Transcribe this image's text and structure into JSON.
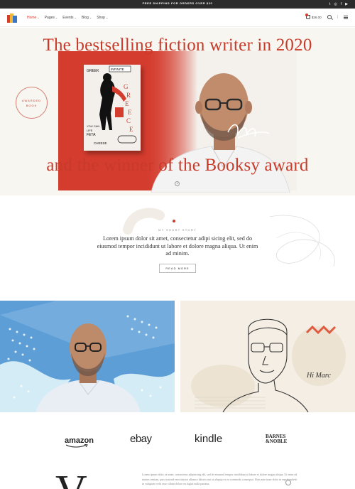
{
  "topbar": {
    "promo": "FREE SHIPPING FOR ORDERS OVER $20",
    "socials": [
      "t",
      "◎",
      "f",
      "▶"
    ]
  },
  "nav": {
    "items": [
      {
        "label": "Home",
        "active": true
      },
      {
        "label": "Pages",
        "active": false
      },
      {
        "label": "Events",
        "active": false
      },
      {
        "label": "Blog",
        "active": false
      },
      {
        "label": "Shop",
        "active": false
      }
    ],
    "chevron": "⌄"
  },
  "header": {
    "cart_total": "$26.00",
    "separator": "|"
  },
  "hero": {
    "title_top": "The bestselling fiction writer in 2020",
    "title_bottom": "and the winner of the Booksy award",
    "badge_line1": "AWARDED",
    "badge_line2": "BOOK",
    "book_title": "GREECE",
    "book_words": [
      "INFINITE",
      "GREEK",
      "FETA",
      "YOU CAN",
      "CHEESE",
      "LIFE"
    ],
    "accent_color": "#d43c2e"
  },
  "story": {
    "label": "MY SHORT STORY",
    "text": "Lorem ipsum dolor sit amet, consectetur adipi sicing elit, sed do eiusmod tempor incididunt ut labore et dolore magna aliqua. Ut enim ad minim.",
    "button": "READ MORE"
  },
  "panels": {
    "signature_text": "Hi Marc"
  },
  "partners": {
    "amazon": "amazon",
    "ebay": "ebay",
    "kindle": "kindle",
    "bn_line1": "BARNES",
    "bn_line2": "&NOBLE"
  },
  "bottom": {
    "dropcap": "V",
    "text": "Lorem ipsum dolor sit amet, consectetur adipisicing elit, sed do eiusmod tempor incididunt ut labore et dolore magna aliqua. Ut enim ad minim veniam, quis nostrud exercitation ullamco laboris nisi ut aliquip ex ea commodo consequat. Duis aute irure dolor in reprehenderit in voluptate velit esse cillum dolore eu fugiat nulla pariatur."
  }
}
